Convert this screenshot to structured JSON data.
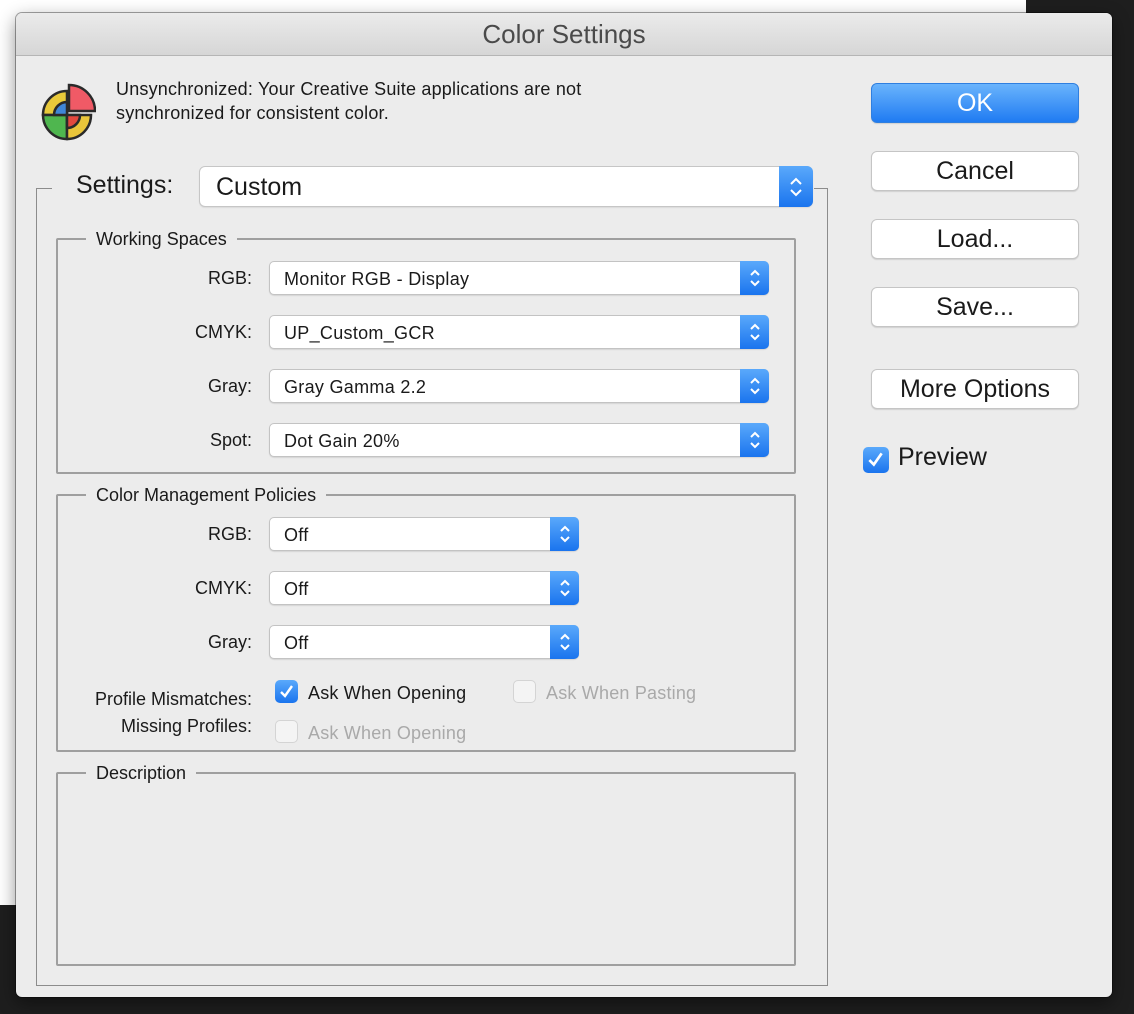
{
  "dialog": {
    "title": "Color Settings",
    "sync_message": "Unsynchronized: Your Creative Suite applications are not synchronized for consistent color.",
    "app_icon": "color-wheel-icon"
  },
  "settings": {
    "label": "Settings:",
    "value": "Custom"
  },
  "working_spaces": {
    "title": "Working Spaces",
    "rows": [
      {
        "label": "RGB:",
        "value": "Monitor RGB - Display"
      },
      {
        "label": "CMYK:",
        "value": "UP_Custom_GCR"
      },
      {
        "label": "Gray:",
        "value": "Gray Gamma 2.2"
      },
      {
        "label": "Spot:",
        "value": "Dot Gain 20%"
      }
    ]
  },
  "policies": {
    "title": "Color Management Policies",
    "rows": [
      {
        "label": "RGB:",
        "value": "Off"
      },
      {
        "label": "CMYK:",
        "value": "Off"
      },
      {
        "label": "Gray:",
        "value": "Off"
      }
    ],
    "profile_mismatches_label": "Profile Mismatches:",
    "missing_profiles_label": "Missing Profiles:",
    "mismatch_ask_opening": {
      "label": "Ask When Opening",
      "checked": true,
      "enabled": true
    },
    "mismatch_ask_pasting": {
      "label": "Ask When Pasting",
      "checked": false,
      "enabled": false
    },
    "missing_ask_opening": {
      "label": "Ask When Opening",
      "checked": false,
      "enabled": false
    }
  },
  "description": {
    "title": "Description",
    "text": ""
  },
  "buttons": {
    "ok": "OK",
    "cancel": "Cancel",
    "load": "Load...",
    "save": "Save...",
    "more_options": "More Options"
  },
  "preview": {
    "label": "Preview",
    "checked": true
  },
  "colors": {
    "accent": "#1a74ee",
    "dialog_bg": "#ececec",
    "disabled_text": "#a9a9a9"
  }
}
